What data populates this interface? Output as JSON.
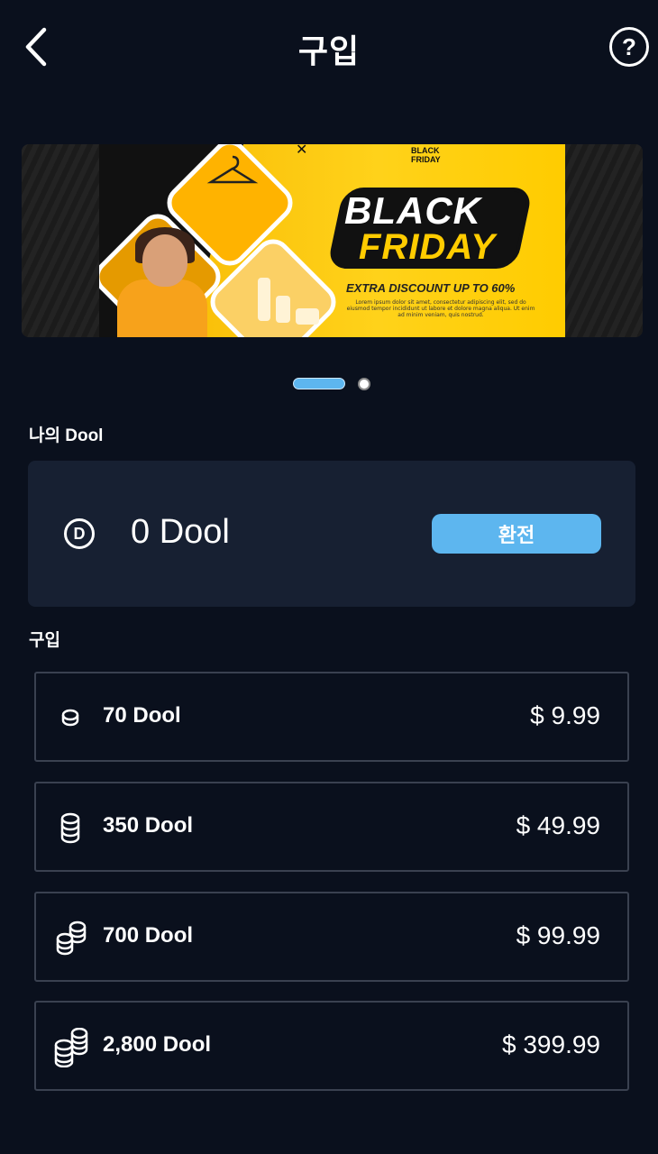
{
  "header": {
    "title": "구입",
    "back_icon": "chevron-left-icon",
    "help_label": "?"
  },
  "banner": {
    "tag_line1": "BLACK",
    "tag_line2": "FRIDAY",
    "headline1": "BLACK",
    "headline2": "FRIDAY",
    "subline": "EXTRA DISCOUNT UP TO 60%",
    "lorem": "Lorem ipsum dolor sit amet, consectetur adipiscing elit, sed do eiusmod tempor incididunt ut labore et dolore magna aliqua. Ut enim ad minim veniam, quis nostrud.",
    "accent_color": "#ffcc00"
  },
  "carousel": {
    "pages": 2,
    "active_index": 0,
    "active_color": "#5db6ef"
  },
  "wallet": {
    "section_label": "나의 Dool",
    "icon_letter": "D",
    "balance": "0 Dool",
    "exchange_label": "환전",
    "button_color": "#5db6ef"
  },
  "purchase": {
    "section_label": "구입",
    "items": [
      {
        "name": "70 Dool",
        "price": "$ 9.99",
        "icon": "single-coin-icon"
      },
      {
        "name": "350 Dool",
        "price": "$ 49.99",
        "icon": "coin-stack-icon"
      },
      {
        "name": "700 Dool",
        "price": "$ 99.99",
        "icon": "coin-pile-icon"
      },
      {
        "name": "2,800 Dool",
        "price": "$ 399.99",
        "icon": "coin-pile-large-icon"
      }
    ]
  }
}
